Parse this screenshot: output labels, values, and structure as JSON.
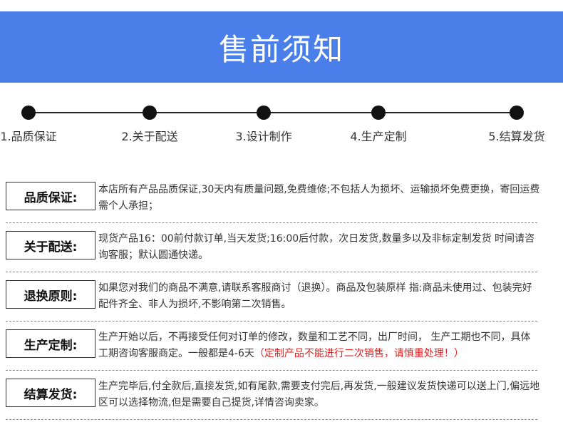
{
  "banner": {
    "title": "售前须知",
    "color": "#4a7ee8"
  },
  "steps": [
    {
      "label": "1.品质保证"
    },
    {
      "label": "2.关于配送"
    },
    {
      "label": "3.设计制作"
    },
    {
      "label": "4.生产定制"
    },
    {
      "label": "5.结算发货"
    }
  ],
  "sections": [
    {
      "label": "品质保证:",
      "text": "本店所有产品品质保证,30天内有质量问题,免费维修;不包括人为损坏、运输损坏免费更换，寄回运费需个人承担；"
    },
    {
      "label": "关于配送:",
      "text": " 现货产品16：00前付款订单,当天发货;16:00后付款，次日发货,数量多以及非标定制发货 时间请咨询客服；默认圆通快递。"
    },
    {
      "label": "退换原则:",
      "text": "如果您对我们的商品不满意,请联系客服商讨（退换）。商品及包装原样 指:商品未使用过、包装完好配件齐全、非人为损坏,不影响第二次销售。"
    },
    {
      "label": "生产定制:",
      "text": "生产开始以后，不再接受任何对订单的修改，数量和工艺不同，出厂时间， 生产工期也不同，具体工期咨询客服商定。一般都是4-6天",
      "warning": "（定制产品不能进行二次销售，请慎重处理！）",
      "warning_color": "#e02020"
    },
    {
      "label": "结算发货:",
      "text": "生产完毕后,付全款后,直接发货,如有尾款,需要支付完后,再发货,一般建议发货快递可以送上门,偏远地区可以选择物流,但是需要自己提货,详情咨询卖家。"
    }
  ]
}
